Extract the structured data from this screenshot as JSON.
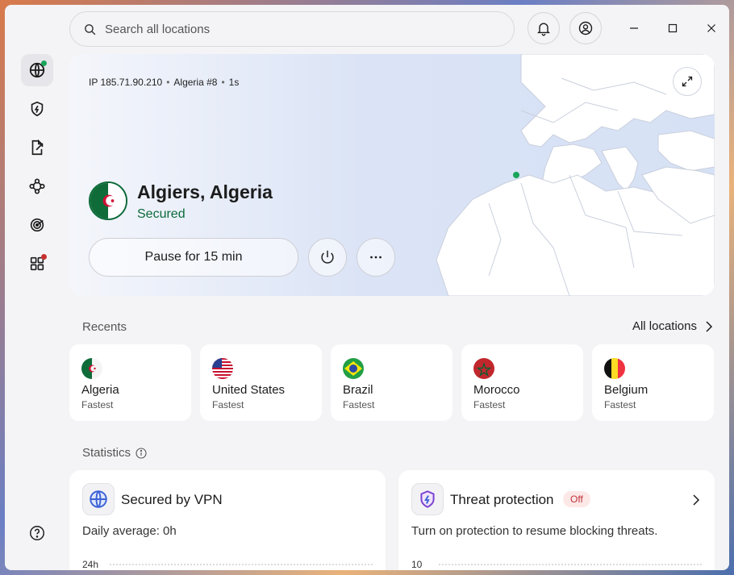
{
  "search": {
    "placeholder": "Search all locations"
  },
  "connection": {
    "ip_label": "IP 185.71.90.210",
    "server": "Algeria #8",
    "duration": "1s",
    "title": "Algiers, Algeria",
    "status": "Secured",
    "pause_label": "Pause for 15 min"
  },
  "recents": {
    "label": "Recents",
    "all_locations_label": "All locations",
    "items": [
      {
        "name": "Algeria",
        "sub": "Fastest"
      },
      {
        "name": "United States",
        "sub": "Fastest"
      },
      {
        "name": "Brazil",
        "sub": "Fastest"
      },
      {
        "name": "Morocco",
        "sub": "Fastest"
      },
      {
        "name": "Belgium",
        "sub": "Fastest"
      }
    ]
  },
  "statistics": {
    "label": "Statistics",
    "vpn": {
      "title": "Secured by VPN",
      "desc": "Daily average: 0h",
      "axis_label": "24h"
    },
    "threat": {
      "title": "Threat protection",
      "badge": "Off",
      "desc": "Turn on protection to resume blocking threats.",
      "axis_label": "10"
    }
  },
  "colors": {
    "accent_green": "#0b6b3a",
    "status_dot": "#1aa55b",
    "off_badge_text": "#c0333a"
  },
  "icons": {
    "sidebar": [
      "globe-icon",
      "shield-bolt-icon",
      "split-tunnel-icon",
      "meshnet-icon",
      "target-icon",
      "apps-icon",
      "help-icon"
    ]
  }
}
